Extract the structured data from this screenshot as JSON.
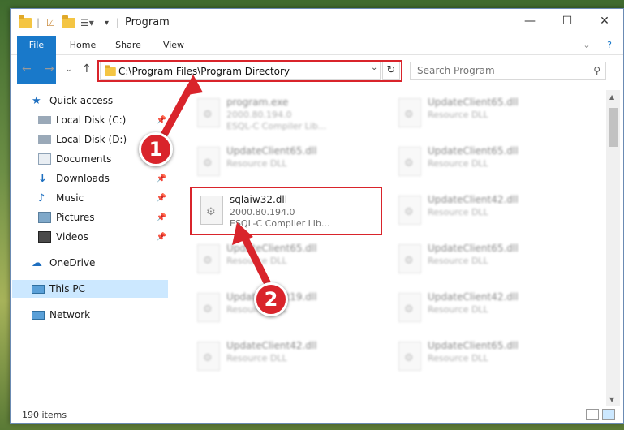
{
  "window": {
    "title": "Program",
    "controls": {
      "minimize": "—",
      "maximize": "☐",
      "close": "✕"
    }
  },
  "ribbon": {
    "tabs": [
      "File",
      "Home",
      "Share",
      "View"
    ],
    "help": "?"
  },
  "address": {
    "path": "C:\\Program Files\\Program Directory",
    "search_placeholder": "Search Program"
  },
  "sidebar": {
    "items": [
      {
        "label": "Quick access",
        "icon": "star-icon"
      },
      {
        "label": "Local Disk (C:)",
        "icon": "drive-icon"
      },
      {
        "label": "Local Disk (D:)",
        "icon": "drive-icon"
      },
      {
        "label": "Documents",
        "icon": "documents-icon"
      },
      {
        "label": "Downloads",
        "icon": "download-icon"
      },
      {
        "label": "Music",
        "icon": "music-icon"
      },
      {
        "label": "Pictures",
        "icon": "pictures-icon"
      },
      {
        "label": "Videos",
        "icon": "videos-icon"
      },
      {
        "label": "OneDrive",
        "icon": "cloud-icon"
      },
      {
        "label": "This PC",
        "icon": "computer-icon"
      },
      {
        "label": "Network",
        "icon": "network-icon"
      }
    ]
  },
  "files": [
    {
      "name": "program.exe",
      "line2": "2000.80.194.0",
      "line3": "ESQL-C Compiler Lib..."
    },
    {
      "name": "UpdateClient65.dll",
      "line2": "Resource DLL",
      "line3": ""
    },
    {
      "name": "UpdateClient65.dll",
      "line2": "Resource DLL",
      "line3": ""
    },
    {
      "name": "UpdateClient65.dll",
      "line2": "Resource DLL",
      "line3": ""
    },
    {
      "name": "sqlaiw32.dll",
      "line2": "2000.80.194.0",
      "line3": "ESQL-C Compiler Lib..."
    },
    {
      "name": "UpdateClient42.dll",
      "line2": "Resource DLL",
      "line3": ""
    },
    {
      "name": "UpdateClient65.dll",
      "line2": "Resource DLL",
      "line3": ""
    },
    {
      "name": "UpdateClient65.dll",
      "line2": "Resource DLL",
      "line3": ""
    },
    {
      "name": "UpdateClient19.dll",
      "line2": "Resource DLL",
      "line3": ""
    },
    {
      "name": "UpdateClient42.dll",
      "line2": "Resource DLL",
      "line3": ""
    },
    {
      "name": "UpdateClient42.dll",
      "line2": "Resource DLL",
      "line3": ""
    },
    {
      "name": "UpdateClient65.dll",
      "line2": "Resource DLL",
      "line3": ""
    }
  ],
  "status": {
    "count": "190 items"
  },
  "callouts": [
    "1",
    "2"
  ],
  "colors": {
    "accent": "#1979ca",
    "highlight": "#d9242b",
    "selected": "#cce8ff"
  }
}
